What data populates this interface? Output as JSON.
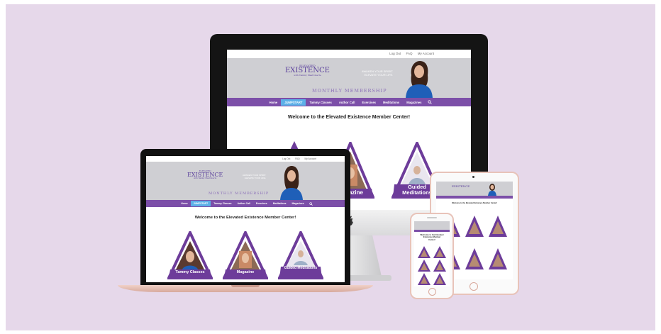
{
  "site": {
    "topbar_links": [
      "Log Out",
      "FAQ",
      "My Account"
    ],
    "logo": {
      "top": "ELEVATED",
      "main": "EXISTENCE",
      "sub": "with Tammy Mastroberte"
    },
    "tagline": [
      "AWAKEN YOUR SPIRIT.",
      "ELEVATE YOUR LIFE."
    ],
    "membership": "MONTHLY MEMBERSHIP",
    "nav": [
      {
        "label": "Home",
        "active": false
      },
      {
        "label": "JUMPSTART",
        "active": true
      },
      {
        "label": "Tammy Classes",
        "active": false
      },
      {
        "label": "Author Call",
        "active": false
      },
      {
        "label": "Exercises",
        "active": false
      },
      {
        "label": "Meditations",
        "active": false
      },
      {
        "label": "Magazines",
        "active": false
      }
    ],
    "search_icon": "search-icon",
    "welcome": "Welcome to the Elevated Existence Member Center!",
    "welcome_mobile": [
      "Welcome to the Elevated",
      "Existence Member",
      "Center!"
    ],
    "tiles": [
      "Tammy Classes",
      "Magazine",
      "Guided Meditations"
    ]
  },
  "devices": [
    "desktop-monitor",
    "laptop",
    "tablet",
    "phone"
  ],
  "colors": {
    "background": "#e6d8ea",
    "brand_purple": "#7c4fa8",
    "active_blue": "#5db0e8",
    "banner_gray": "#cfcfd3",
    "device_black": "#141414",
    "rose_gold": "#e3b9b0"
  },
  "icons": [
    "apple-logo-icon",
    "search-icon"
  ]
}
